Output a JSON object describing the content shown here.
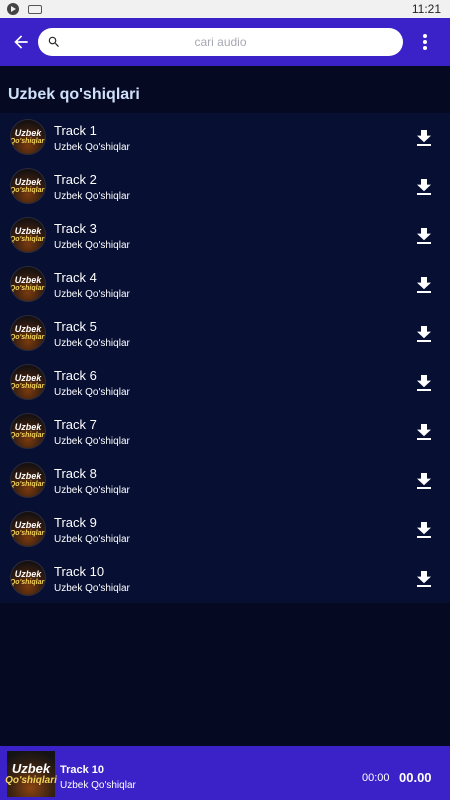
{
  "status_bar": {
    "time": "11:21"
  },
  "search": {
    "placeholder": "cari audio",
    "value": ""
  },
  "section": {
    "title": "Uzbek qo'shiqlari"
  },
  "artwork": {
    "line1": "Uzbek",
    "line2": "Qo'shiqlari"
  },
  "tracks": [
    {
      "title": "Track 1",
      "artist": "Uzbek Qo'shiqlar"
    },
    {
      "title": "Track 2",
      "artist": "Uzbek Qo'shiqlar"
    },
    {
      "title": "Track 3",
      "artist": "Uzbek Qo'shiqlar"
    },
    {
      "title": "Track 4",
      "artist": "Uzbek Qo'shiqlar"
    },
    {
      "title": "Track 5",
      "artist": "Uzbek Qo'shiqlar"
    },
    {
      "title": "Track 6",
      "artist": "Uzbek Qo'shiqlar"
    },
    {
      "title": "Track 7",
      "artist": "Uzbek Qo'shiqlar"
    },
    {
      "title": "Track 8",
      "artist": "Uzbek Qo'shiqlar"
    },
    {
      "title": "Track 9",
      "artist": "Uzbek Qo'shiqlar"
    },
    {
      "title": "Track 10",
      "artist": "Uzbek Qo'shiqlar"
    }
  ],
  "player": {
    "title": "Track 10",
    "artist": "Uzbek Qo'shiqlar",
    "elapsed": "00:00",
    "duration": "00.00"
  },
  "icons": {
    "back": "arrow-back-icon",
    "search": "search-icon",
    "menu": "more-vert-icon",
    "download": "download-icon"
  },
  "colors": {
    "app_bar": "#3a22c8",
    "background": "#050a22",
    "list_background": "#070f33",
    "section_title": "#cfe0f8"
  }
}
